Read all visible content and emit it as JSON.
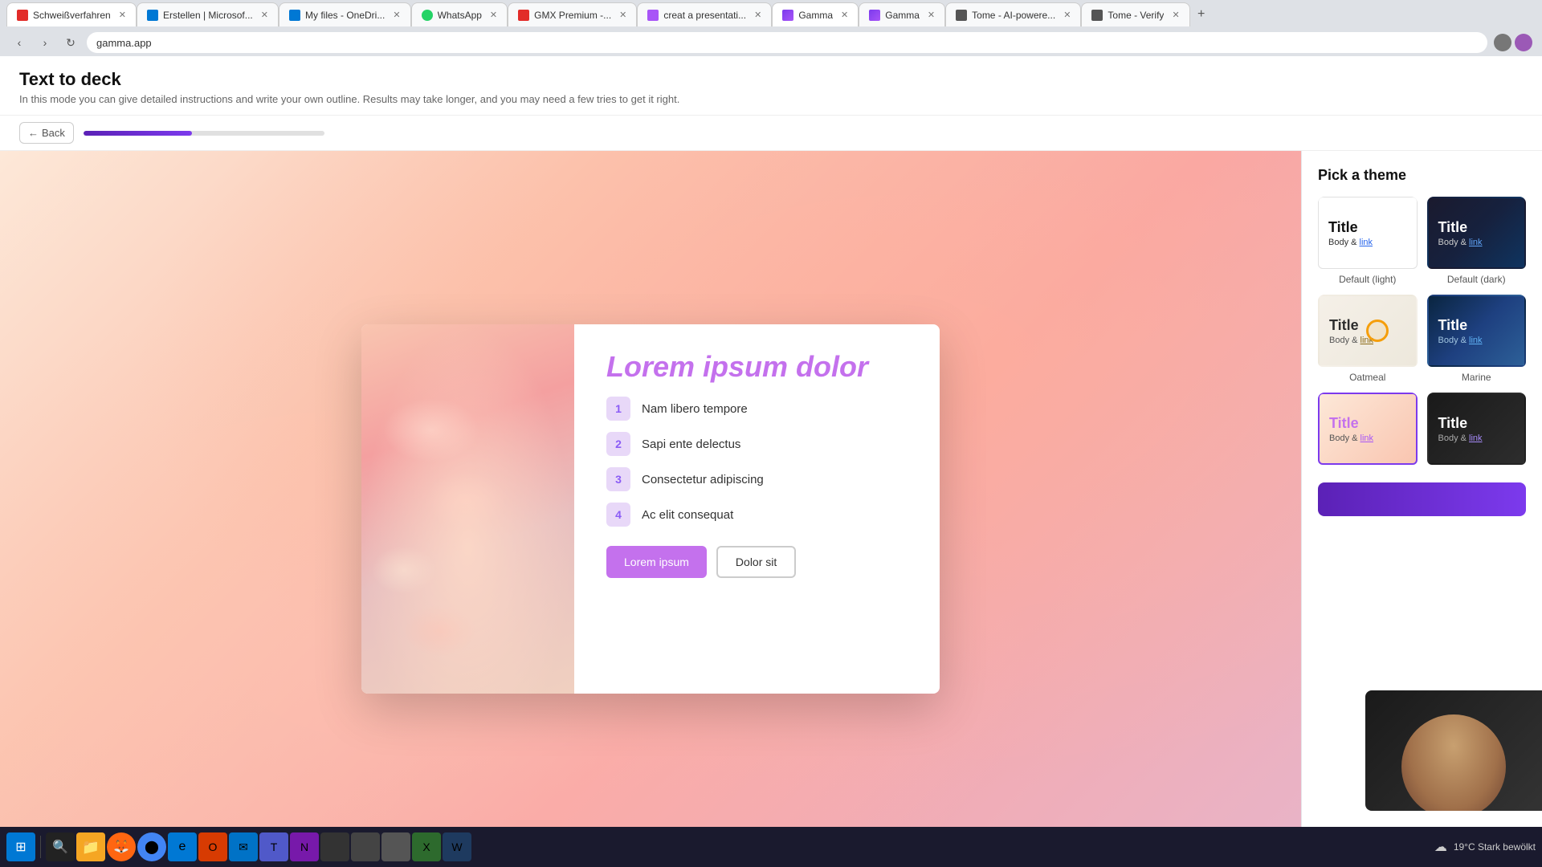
{
  "browser": {
    "tabs": [
      {
        "id": "tab1",
        "label": "Schweißverfahren",
        "active": false,
        "favicon_color": "#e22c29"
      },
      {
        "id": "tab2",
        "label": "Erstellen | Microsof...",
        "active": false,
        "favicon_color": "#0078d4"
      },
      {
        "id": "tab3",
        "label": "My files - OneDri...",
        "active": false,
        "favicon_color": "#0078d4"
      },
      {
        "id": "tab4",
        "label": "WhatsApp",
        "active": false,
        "favicon_color": "#25d366"
      },
      {
        "id": "tab5",
        "label": "GMX Premium -...",
        "active": false,
        "favicon_color": "#e22c29"
      },
      {
        "id": "tab6",
        "label": "creat a presentati...",
        "active": false,
        "favicon_color": "#a855f7"
      },
      {
        "id": "tab7",
        "label": "Gamma",
        "active": true,
        "favicon_color": "#7c3aed"
      },
      {
        "id": "tab8",
        "label": "Gamma",
        "active": false,
        "favicon_color": "#7c3aed"
      },
      {
        "id": "tab9",
        "label": "Tome - AI-powere...",
        "active": false,
        "favicon_color": "#333"
      },
      {
        "id": "tab10",
        "label": "Tome - Verify",
        "active": false,
        "favicon_color": "#333"
      }
    ],
    "address": "gamma.app"
  },
  "app": {
    "title": "Text to deck",
    "subtitle": "In this mode you can give detailed instructions and write your own outline. Results may take longer, and you may need a few tries to get it right.",
    "back_label": "Back",
    "progress_percent": 45
  },
  "slide": {
    "title": "Lorem ipsum dolor",
    "items": [
      {
        "num": "1",
        "text": "Nam libero tempore"
      },
      {
        "num": "2",
        "text": "Sapi ente delectus"
      },
      {
        "num": "3",
        "text": "Consectetur adipiscing"
      },
      {
        "num": "4",
        "text": "Ac elit consequat"
      }
    ],
    "btn_primary": "Lorem ipsum",
    "btn_secondary": "Dolor sit"
  },
  "theme_panel": {
    "title": "Pick a theme",
    "themes": [
      {
        "id": "default-light",
        "title": "Title",
        "body": "Body & ",
        "link": "link",
        "label": "Default (light)",
        "selected": false
      },
      {
        "id": "default-dark",
        "title": "Title",
        "body": "Body & ",
        "link": "link",
        "label": "Default (dark)",
        "selected": false
      },
      {
        "id": "oatmeal",
        "title": "Title",
        "body": "Body & ",
        "link": "link",
        "label": "Oatmeal",
        "selected": false
      },
      {
        "id": "marine",
        "title": "Title",
        "body": "Body & ",
        "link": "link",
        "label": "Marine",
        "selected": false
      },
      {
        "id": "warm",
        "title": "Title",
        "body": "Body & ",
        "link": "link",
        "label": "",
        "selected": true
      },
      {
        "id": "dark2",
        "title": "Title",
        "body": "Body & ",
        "link": "link",
        "label": "",
        "selected": false
      }
    ],
    "cta_label": ""
  },
  "taskbar": {
    "weather": "19°C  Stark bewölkt",
    "time": ""
  }
}
